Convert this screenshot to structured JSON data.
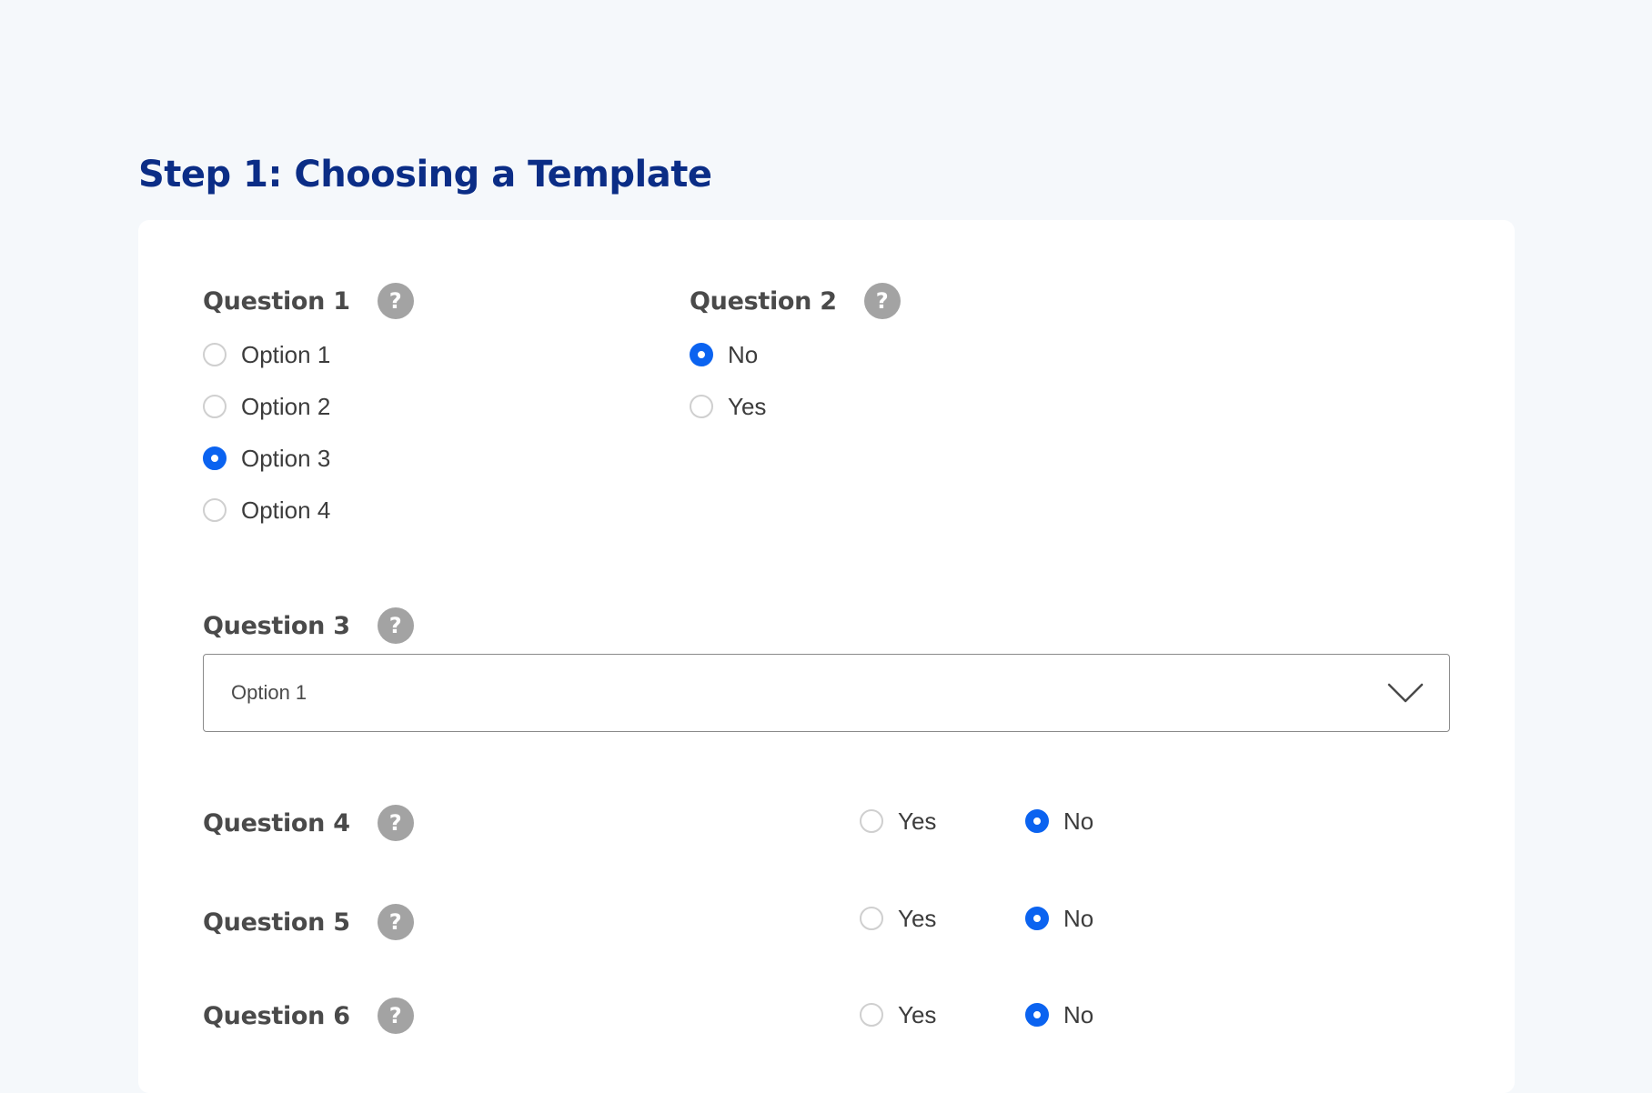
{
  "page": {
    "title": "Step 1: Choosing a Template"
  },
  "questions": {
    "q1": {
      "label": "Question 1",
      "options": [
        "Option 1",
        "Option 2",
        "Option 3",
        "Option 4"
      ],
      "selected": "Option 3"
    },
    "q2": {
      "label": "Question 2",
      "options": [
        "No",
        "Yes"
      ],
      "selected": "No"
    },
    "q3": {
      "label": "Question 3",
      "value": "Option 1"
    },
    "q4": {
      "label": "Question 4",
      "options": [
        "Yes",
        "No"
      ],
      "selected": "No"
    },
    "q5": {
      "label": "Question 5",
      "options": [
        "Yes",
        "No"
      ],
      "selected": "No"
    },
    "q6": {
      "label": "Question 6",
      "options": [
        "Yes",
        "No"
      ],
      "selected": "No"
    }
  },
  "icons": {
    "help": "question-mark-circle",
    "help_glyph": "?",
    "dropdown": "chevron-down"
  },
  "colors": {
    "title": "#0b2d86",
    "accent": "#0b63f0",
    "help_icon_bg": "#a3a3a3",
    "background": "#f5f8fb",
    "card": "#ffffff"
  }
}
